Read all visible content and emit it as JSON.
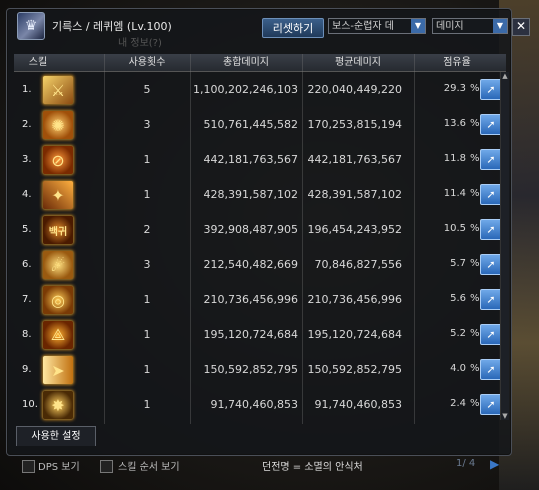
{
  "header": {
    "character": "기륵스 / 레퀴엠 (Lv.100)",
    "faint_sub": "내 정보(?)",
    "reset_label": "리셋하기",
    "dungeon_select": "보스-순렵자 데",
    "metric_select": "데미지",
    "close_symbol": "✕"
  },
  "columns": {
    "skill": "스킬",
    "uses": "사용횟수",
    "total": "총합데미지",
    "avg": "평균데미지",
    "share": "점유율"
  },
  "rows": [
    {
      "num": "1.",
      "uses": "5",
      "total": "1,100,202,246,103",
      "avg": "220,040,449,220",
      "share": "29.3",
      "pct": "%"
    },
    {
      "num": "2.",
      "uses": "3",
      "total": "510,761,445,582",
      "avg": "170,253,815,194",
      "share": "13.6",
      "pct": "%"
    },
    {
      "num": "3.",
      "uses": "1",
      "total": "442,181,763,567",
      "avg": "442,181,763,567",
      "share": "11.8",
      "pct": "%"
    },
    {
      "num": "4.",
      "uses": "1",
      "total": "428,391,587,102",
      "avg": "428,391,587,102",
      "share": "11.4",
      "pct": "%"
    },
    {
      "num": "5.",
      "uses": "2",
      "total": "392,908,487,905",
      "avg": "196,454,243,952",
      "share": "10.5",
      "pct": "%",
      "icon_text": "백귀"
    },
    {
      "num": "6.",
      "uses": "3",
      "total": "212,540,482,669",
      "avg": "70,846,827,556",
      "share": "5.7",
      "pct": "%"
    },
    {
      "num": "7.",
      "uses": "1",
      "total": "210,736,456,996",
      "avg": "210,736,456,996",
      "share": "5.6",
      "pct": "%"
    },
    {
      "num": "8.",
      "uses": "1",
      "total": "195,120,724,684",
      "avg": "195,120,724,684",
      "share": "5.2",
      "pct": "%"
    },
    {
      "num": "9.",
      "uses": "1",
      "total": "150,592,852,795",
      "avg": "150,592,852,795",
      "share": "4.0",
      "pct": "%"
    },
    {
      "num": "10.",
      "uses": "1",
      "total": "91,740,460,853",
      "avg": "91,740,460,853",
      "share": "2.4",
      "pct": "%"
    }
  ],
  "used_tab": "사용한 설정",
  "footer": {
    "dps_label": "DPS 보기",
    "order_label": "스킬 순서 보기",
    "dungeon": "던전명 = 소멸의 안식처",
    "page": "1/ 4"
  },
  "icons": [
    "portrait-icon",
    "skill-icon",
    "share-arrow-icon"
  ],
  "colors": {
    "accent": "#2a68b8",
    "border": "#4a4f58",
    "panel": "#14161a"
  }
}
